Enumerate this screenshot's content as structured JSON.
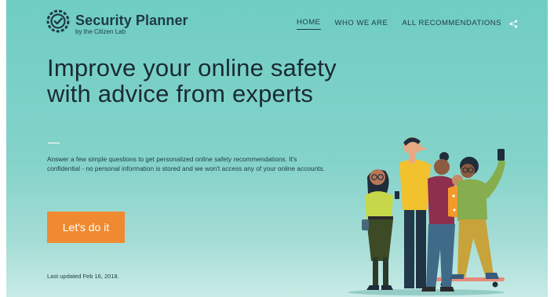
{
  "brand": {
    "title": "Security Planner",
    "subtitle": "by the Citizen Lab",
    "logo_icon": "shield-check-icon",
    "color": "#1f3a44"
  },
  "nav": {
    "items": [
      {
        "label": "HOME",
        "active": true
      },
      {
        "label": "WHO WE ARE",
        "active": false
      },
      {
        "label": "ALL RECOMMENDATIONS",
        "active": false
      }
    ],
    "share_icon": "share-icon"
  },
  "hero": {
    "headline": "Improve your online safety with advice from experts",
    "description": "Answer a few simple questions to get personalized online safety recommendations. It's confidential - no personal information is stored and we won't access any of your online accounts.",
    "cta_label": "Let's do it",
    "cta_color": "#ef8a30",
    "background": "#6fcdc3",
    "updated": "Last updated Feb 16, 2018."
  }
}
